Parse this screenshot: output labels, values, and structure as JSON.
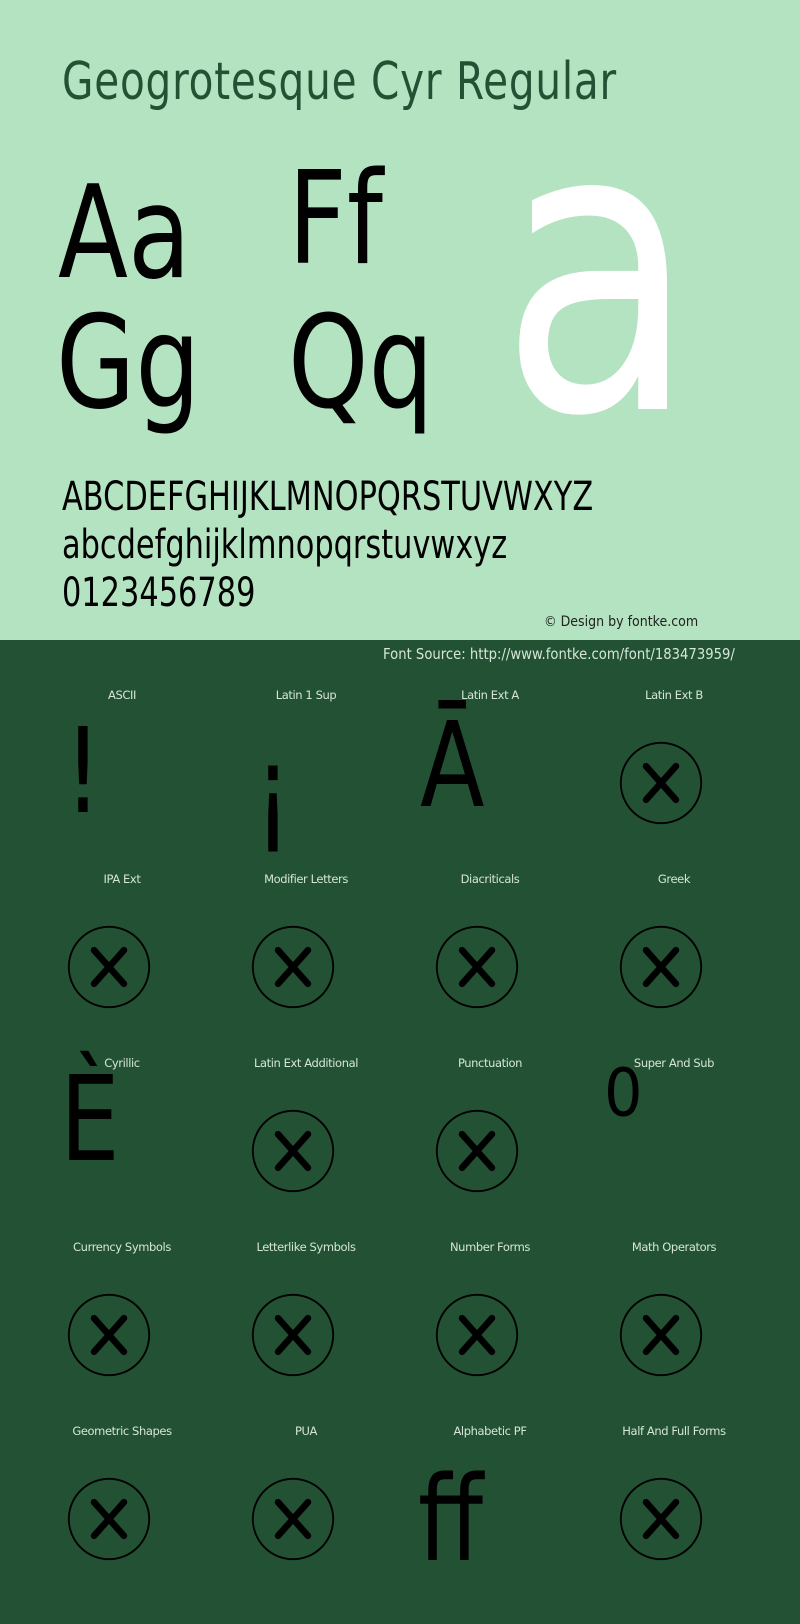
{
  "header": {
    "title": "Geogrotesque Cyr Regular",
    "sample_pairs": [
      "Aa",
      "Ff",
      "Gg",
      "Qq"
    ],
    "hero_glyph": "a",
    "uppercase": "ABCDEFGHIJKLMNOPQRSTUVWXYZ",
    "lowercase": "abcdefghijklmnopqrstuvwxyz",
    "digits": "0123456789",
    "copyright": "© Design by fontke.com"
  },
  "source": {
    "label": "Font Source: http://www.fontke.com/font/183473959/"
  },
  "colors": {
    "top_background": "#b4e3c1",
    "bottom_background": "#235134",
    "title_color": "#235134",
    "hero_glyph_color": "#ffffff",
    "label_color": "#d4e6d8"
  },
  "blocks": [
    {
      "label": "ASCII",
      "glyph": "!",
      "supported": true
    },
    {
      "label": "Latin 1 Sup",
      "glyph": "¡",
      "supported": true
    },
    {
      "label": "Latin Ext A",
      "glyph": "Ā",
      "supported": true
    },
    {
      "label": "Latin Ext B",
      "glyph": "",
      "supported": false
    },
    {
      "label": "IPA Ext",
      "glyph": "",
      "supported": false
    },
    {
      "label": "Modifier Letters",
      "glyph": "",
      "supported": false
    },
    {
      "label": "Diacriticals",
      "glyph": "",
      "supported": false
    },
    {
      "label": "Greek",
      "glyph": "",
      "supported": false
    },
    {
      "label": "Cyrillic",
      "glyph": "È",
      "supported": true
    },
    {
      "label": "Latin Ext Additional",
      "glyph": "",
      "supported": false
    },
    {
      "label": "Punctuation",
      "glyph": "",
      "supported": false
    },
    {
      "label": "Super And Sub",
      "glyph": "⁰",
      "supported": true
    },
    {
      "label": "Currency Symbols",
      "glyph": "",
      "supported": false
    },
    {
      "label": "Letterlike Symbols",
      "glyph": "",
      "supported": false
    },
    {
      "label": "Number Forms",
      "glyph": "",
      "supported": false
    },
    {
      "label": "Math Operators",
      "glyph": "",
      "supported": false
    },
    {
      "label": "Geometric Shapes",
      "glyph": "",
      "supported": false
    },
    {
      "label": "PUA",
      "glyph": "",
      "supported": false
    },
    {
      "label": "Alphabetic PF",
      "glyph": "ff",
      "supported": true
    },
    {
      "label": "Half And Full Forms",
      "glyph": "",
      "supported": false
    }
  ]
}
